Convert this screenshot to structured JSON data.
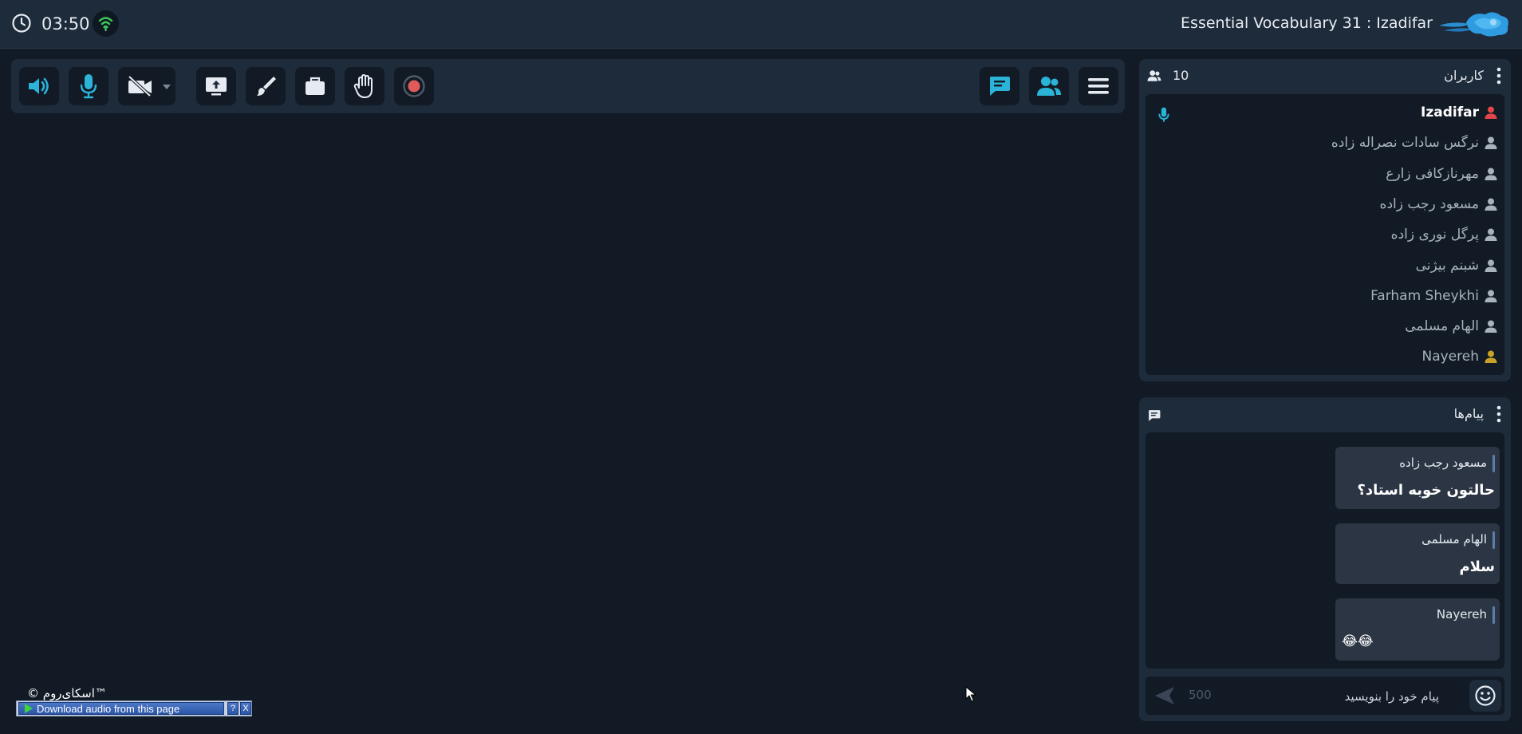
{
  "header": {
    "timer": "03:50",
    "room_title": "Essential Vocabulary 31 : Izadifar",
    "icons": [
      "clock-icon",
      "wifi-signal-icon",
      "skyroom-logo"
    ]
  },
  "toolbar": {
    "left_tools": [
      "speaker-icon",
      "microphone-icon",
      "camera-off-icon",
      "dropdown-arrow-icon",
      "screen-share-icon",
      "whiteboard-brush-icon",
      "file-box-icon",
      "raise-hand-icon",
      "record-icon"
    ],
    "right_tools": [
      "chat-icon",
      "users-icon",
      "menu-icon"
    ]
  },
  "users_panel": {
    "title": "کاربران",
    "count": "10",
    "users": [
      {
        "name": "Izadifar",
        "role": "host",
        "icon_color": "#e0454a"
      },
      {
        "name": "نرگس سادات نصراله زاده",
        "role": "user",
        "icon_color": "#a8b2bd"
      },
      {
        "name": "مهرنازکافی زارع",
        "role": "user",
        "icon_color": "#a8b2bd"
      },
      {
        "name": "مسعود رجب زاده",
        "role": "user",
        "icon_color": "#a8b2bd"
      },
      {
        "name": "پرگل نوری زاده",
        "role": "user",
        "icon_color": "#a8b2bd"
      },
      {
        "name": "شبنم بیژنی",
        "role": "user",
        "icon_color": "#a8b2bd"
      },
      {
        "name": "Farham Sheykhi",
        "role": "user",
        "icon_color": "#a8b2bd"
      },
      {
        "name": "الهام مسلمی",
        "role": "user",
        "icon_color": "#a8b2bd"
      },
      {
        "name": "Nayereh",
        "role": "user",
        "icon_color": "#c9a227"
      }
    ]
  },
  "messages_panel": {
    "title": "پیام‌ها",
    "messages": [
      {
        "sender": "مسعود رجب زاده",
        "text": "حالتون خوبه استاد؟"
      },
      {
        "sender": "الهام مسلمی",
        "text": "سلام"
      },
      {
        "sender": "Nayereh",
        "text": "😂😂"
      }
    ],
    "input_placeholder": "پیام خود را بنویسید",
    "char_limit": "500"
  },
  "footer": {
    "copyright": "© اسکای‌روم™"
  },
  "download_bar": {
    "label": "Download audio from this page",
    "help": "?",
    "close": "X"
  },
  "colors": {
    "background": "#111a25",
    "panel": "#1e2b3b",
    "accent": "#2bb3d8",
    "host": "#e0454a",
    "record": "#e05a5a"
  }
}
